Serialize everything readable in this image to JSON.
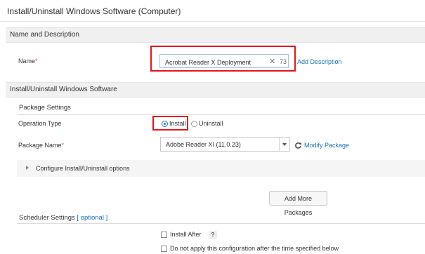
{
  "page": {
    "title": "Install/Uninstall Windows Software (Computer)"
  },
  "name_section": {
    "header": "Name and Description",
    "name_label": "Name",
    "required_mark": "*",
    "name_value": "Acrobat Reader X Deployment",
    "clear_glyph": "✕",
    "char_count": "73",
    "add_description": "Add Description"
  },
  "software_section": {
    "header": "Install/Uninstall Windows Software",
    "package_settings": {
      "heading": "Package Settings",
      "operation_type_label": "Operation Type",
      "options": [
        {
          "label": "Install",
          "selected": true
        },
        {
          "label": "Uninstall",
          "selected": false
        }
      ],
      "package_name_label": "Package Name",
      "required_mark": "*",
      "package_selected": "Adobe Reader XI (11.0.23)",
      "modify_package": "Modify Package",
      "configure_options": "Configure Install/Uninstall options",
      "add_more_packages": "Add More Packages"
    },
    "scheduler": {
      "heading": "Scheduler Settings",
      "optional": "[ optional ]",
      "install_after": "Install After",
      "help_glyph": "?",
      "do_not_apply": "Do not apply this configuration after the time specified below"
    }
  },
  "colors": {
    "highlight": "#e8121c",
    "link": "#1a6fb5",
    "radio_selected": "#1a73c9"
  }
}
